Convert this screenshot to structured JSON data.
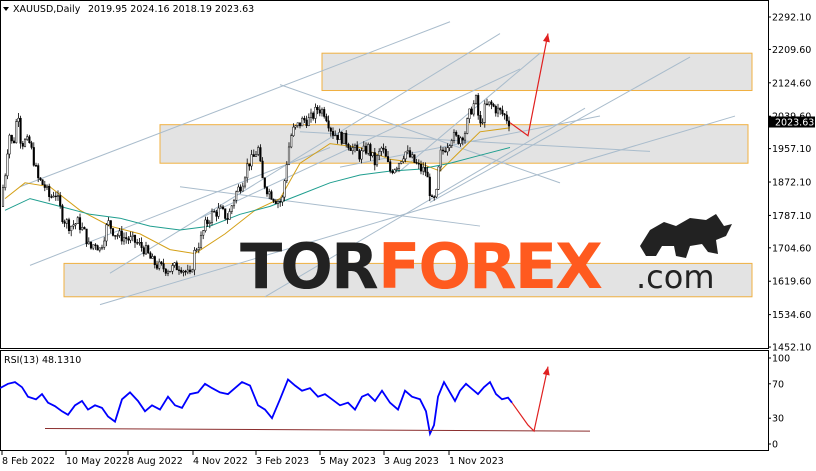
{
  "header": {
    "symbol": "XAUUSD,Daily",
    "ohlc": "2019.95 2024.16 2018.19 2023.63"
  },
  "rsi_header": "RSI(13) 48.1310",
  "watermark": {
    "part1": "TOR",
    "part2": "FOREX",
    "part3": ".com"
  },
  "colors": {
    "bull": "#ffffff",
    "bear": "#000000",
    "ma_fast": "#d4a017",
    "ma_slow": "#1f9e8f",
    "rsi": "#0000ff",
    "zone_fill": "#d9d9d9",
    "zone_border": "#f0b040",
    "trend": "#a9bccc",
    "arrow": "#e02020",
    "brand_dark": "#222222",
    "brand_accent": "#ff5a1f",
    "price_tag": "#000000"
  },
  "chart_data": [
    {
      "type": "candlestick",
      "ylim": [
        1452.2,
        2292.1
      ],
      "y_ticks": [
        "2292.10",
        "2209.60",
        "2124.60",
        "2039.60",
        "1957.10",
        "1872.10",
        "1787.10",
        "1704.60",
        "1619.60",
        "1534.60",
        "1452.10"
      ],
      "x_ticks": [
        "8 Feb 2022",
        "10 May 2022",
        "8 Aug 2022",
        "4 Nov 2022",
        "3 Feb 2023",
        "5 May 2023",
        "3 Aug 2023",
        "1 Nov 2023"
      ],
      "last_price": "2023.63",
      "price_anchors": [
        [
          0,
          1810
        ],
        [
          5,
          1890
        ],
        [
          9,
          2000
        ],
        [
          13,
          1960
        ],
        [
          18,
          2060
        ],
        [
          21,
          1970
        ],
        [
          25,
          1975
        ],
        [
          30,
          1970
        ],
        [
          38,
          1880
        ],
        [
          45,
          1860
        ],
        [
          50,
          1830
        ],
        [
          55,
          1850
        ],
        [
          63,
          1780
        ],
        [
          70,
          1760
        ],
        [
          78,
          1770
        ],
        [
          85,
          1740
        ],
        [
          90,
          1700
        ],
        [
          95,
          1720
        ],
        [
          100,
          1700
        ],
        [
          108,
          1770
        ],
        [
          115,
          1740
        ],
        [
          125,
          1730
        ],
        [
          135,
          1720
        ],
        [
          145,
          1700
        ],
        [
          152,
          1670
        ],
        [
          160,
          1655
        ],
        [
          170,
          1650
        ],
        [
          180,
          1660
        ],
        [
          190,
          1630
        ],
        [
          195,
          1700
        ],
        [
          200,
          1720
        ],
        [
          205,
          1760
        ],
        [
          212,
          1790
        ],
        [
          220,
          1800
        ],
        [
          228,
          1780
        ],
        [
          235,
          1840
        ],
        [
          242,
          1870
        ],
        [
          248,
          1920
        ],
        [
          253,
          1930
        ],
        [
          258,
          1960
        ],
        [
          262,
          1880
        ],
        [
          268,
          1850
        ],
        [
          275,
          1830
        ],
        [
          282,
          1820
        ],
        [
          288,
          1950
        ],
        [
          292,
          2000
        ],
        [
          296,
          2010
        ],
        [
          303,
          2030
        ],
        [
          310,
          2030
        ],
        [
          318,
          2060
        ],
        [
          325,
          2050
        ],
        [
          332,
          2000
        ],
        [
          338,
          1990
        ],
        [
          345,
          1980
        ],
        [
          352,
          1960
        ],
        [
          360,
          1940
        ],
        [
          368,
          1960
        ],
        [
          375,
          1920
        ],
        [
          382,
          1960
        ],
        [
          390,
          1900
        ],
        [
          398,
          1920
        ],
        [
          405,
          1950
        ],
        [
          412,
          1930
        ],
        [
          420,
          1905
        ],
        [
          426,
          1900
        ],
        [
          432,
          1820
        ],
        [
          436,
          1830
        ],
        [
          440,
          1940
        ],
        [
          445,
          1960
        ],
        [
          452,
          1990
        ],
        [
          458,
          1980
        ],
        [
          465,
          2000
        ],
        [
          470,
          2050
        ],
        [
          476,
          2080
        ],
        [
          480,
          2010
        ],
        [
          485,
          2060
        ],
        [
          490,
          2070
        ],
        [
          495,
          2060
        ],
        [
          500,
          2050
        ],
        [
          505,
          2040
        ],
        [
          510,
          2023
        ]
      ],
      "moving_averages": [
        {
          "name": "",
          "color": "#d4a017",
          "points": [
            [
              5,
              1830
            ],
            [
              25,
              1870
            ],
            [
              50,
              1860
            ],
            [
              80,
              1800
            ],
            [
              110,
              1760
            ],
            [
              140,
              1740
            ],
            [
              170,
              1700
            ],
            [
              195,
              1690
            ],
            [
              225,
              1740
            ],
            [
              255,
              1800
            ],
            [
              280,
              1830
            ],
            [
              300,
              1920
            ],
            [
              330,
              1970
            ],
            [
              360,
              1960
            ],
            [
              390,
              1930
            ],
            [
              420,
              1920
            ],
            [
              440,
              1900
            ],
            [
              460,
              1950
            ],
            [
              480,
              2000
            ],
            [
              510,
              2010
            ]
          ]
        },
        {
          "name": "",
          "color": "#1f9e8f",
          "points": [
            [
              5,
              1800
            ],
            [
              30,
              1830
            ],
            [
              60,
              1810
            ],
            [
              90,
              1790
            ],
            [
              120,
              1780
            ],
            [
              150,
              1760
            ],
            [
              180,
              1750
            ],
            [
              210,
              1760
            ],
            [
              240,
              1790
            ],
            [
              270,
              1810
            ],
            [
              300,
              1840
            ],
            [
              330,
              1870
            ],
            [
              360,
              1890
            ],
            [
              390,
              1900
            ],
            [
              420,
              1905
            ],
            [
              450,
              1920
            ],
            [
              480,
              1940
            ],
            [
              510,
              1960
            ]
          ]
        }
      ]
    },
    {
      "type": "line",
      "name": "RSI(13)",
      "value": 48.131,
      "ylim": [
        0,
        100
      ],
      "y_ticks": [
        "100",
        "70",
        "30",
        "0"
      ],
      "points": [
        [
          0,
          65
        ],
        [
          8,
          70
        ],
        [
          15,
          72
        ],
        [
          22,
          66
        ],
        [
          28,
          55
        ],
        [
          36,
          52
        ],
        [
          42,
          58
        ],
        [
          48,
          48
        ],
        [
          55,
          44
        ],
        [
          62,
          38
        ],
        [
          68,
          34
        ],
        [
          75,
          45
        ],
        [
          82,
          50
        ],
        [
          88,
          40
        ],
        [
          95,
          45
        ],
        [
          102,
          42
        ],
        [
          108,
          32
        ],
        [
          115,
          26
        ],
        [
          122,
          52
        ],
        [
          130,
          60
        ],
        [
          138,
          50
        ],
        [
          145,
          38
        ],
        [
          152,
          45
        ],
        [
          160,
          40
        ],
        [
          168,
          55
        ],
        [
          175,
          45
        ],
        [
          182,
          42
        ],
        [
          190,
          58
        ],
        [
          198,
          60
        ],
        [
          205,
          70
        ],
        [
          212,
          65
        ],
        [
          220,
          60
        ],
        [
          228,
          58
        ],
        [
          235,
          65
        ],
        [
          242,
          72
        ],
        [
          250,
          68
        ],
        [
          258,
          45
        ],
        [
          265,
          40
        ],
        [
          272,
          30
        ],
        [
          280,
          52
        ],
        [
          288,
          75
        ],
        [
          295,
          68
        ],
        [
          302,
          62
        ],
        [
          310,
          65
        ],
        [
          318,
          55
        ],
        [
          325,
          58
        ],
        [
          332,
          52
        ],
        [
          340,
          45
        ],
        [
          348,
          48
        ],
        [
          355,
          40
        ],
        [
          362,
          55
        ],
        [
          368,
          58
        ],
        [
          375,
          50
        ],
        [
          382,
          62
        ],
        [
          390,
          48
        ],
        [
          398,
          40
        ],
        [
          405,
          62
        ],
        [
          412,
          55
        ],
        [
          420,
          52
        ],
        [
          426,
          38
        ],
        [
          430,
          12
        ],
        [
          434,
          22
        ],
        [
          438,
          55
        ],
        [
          444,
          72
        ],
        [
          450,
          60
        ],
        [
          455,
          50
        ],
        [
          460,
          62
        ],
        [
          466,
          70
        ],
        [
          472,
          64
        ],
        [
          478,
          58
        ],
        [
          484,
          66
        ],
        [
          490,
          72
        ],
        [
          496,
          58
        ],
        [
          502,
          52
        ],
        [
          508,
          54
        ],
        [
          512,
          48
        ]
      ]
    }
  ],
  "annotations": {
    "zones": [
      {
        "kind": "resistance",
        "low": 2105,
        "high": 2200,
        "start": 322,
        "end": 752
      },
      {
        "kind": "mid",
        "low": 1920,
        "high": 2018,
        "start": 160,
        "end": 748
      },
      {
        "kind": "support",
        "low": 1580,
        "high": 1665,
        "start": 64,
        "end": 752
      }
    ],
    "trendlines": [
      [
        [
          20,
          1860
        ],
        [
          450,
          2280
        ]
      ],
      [
        [
          110,
          1640
        ],
        [
          500,
          2250
        ]
      ],
      [
        [
          200,
          1780
        ],
        [
          520,
          2160
        ]
      ],
      [
        [
          265,
          1580
        ],
        [
          585,
          2060
        ]
      ],
      [
        [
          100,
          1560
        ],
        [
          735,
          2040
        ]
      ],
      [
        [
          280,
          2120
        ],
        [
          560,
          1870
        ]
      ],
      [
        [
          30,
          1660
        ],
        [
          330,
          1960
        ]
      ],
      [
        [
          340,
          1910
        ],
        [
          600,
          2040
        ]
      ],
      [
        [
          430,
          1820
        ],
        [
          690,
          2190
        ]
      ],
      [
        [
          300,
          2000
        ],
        [
          650,
          1950
        ]
      ],
      [
        [
          400,
          1900
        ],
        [
          540,
          2200
        ]
      ],
      [
        [
          180,
          1860
        ],
        [
          480,
          1760
        ]
      ]
    ],
    "forecast_price": [
      [
        510,
        2023
      ],
      [
        528,
        1990
      ],
      [
        548,
        2250
      ]
    ],
    "forecast_rsi": [
      [
        512,
        48
      ],
      [
        528,
        22
      ],
      [
        534,
        15
      ],
      [
        548,
        90
      ]
    ],
    "rsi_trend": [
      [
        45,
        18
      ],
      [
        590,
        15
      ]
    ]
  }
}
